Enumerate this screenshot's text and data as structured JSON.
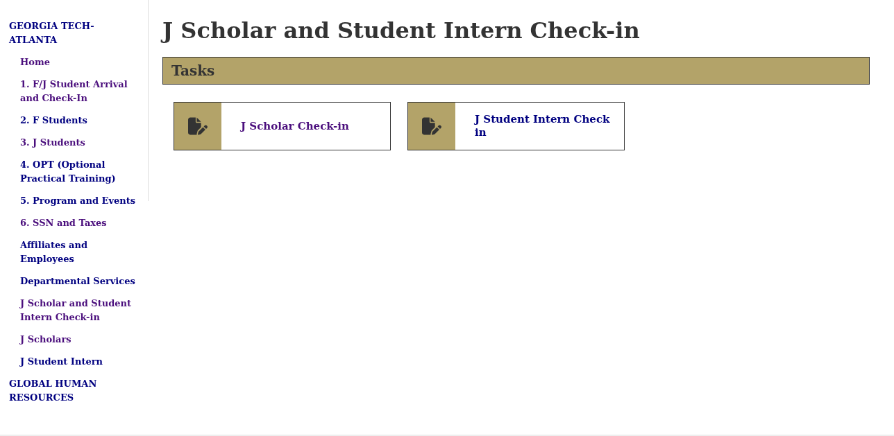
{
  "sidebar": {
    "sections": [
      {
        "label": "GEORGIA TECH-ATLANTA",
        "visited": false,
        "children": [
          {
            "label": "Home",
            "visited": true
          },
          {
            "label": "1. F/J Student Arrival and Check-In",
            "visited": true
          },
          {
            "label": "2. F Students",
            "visited": false
          },
          {
            "label": "3. J Students",
            "visited": true
          },
          {
            "label": "4. OPT (Optional Practical Training)",
            "visited": false
          },
          {
            "label": "5. Program and Events",
            "visited": false
          },
          {
            "label": "6. SSN and Taxes",
            "visited": true
          },
          {
            "label": "Affiliates and Employees",
            "visited": false
          },
          {
            "label": "Departmental Services",
            "visited": false
          },
          {
            "label": "J Scholar and Student Intern Check-in",
            "visited": true
          },
          {
            "label": "J Scholars",
            "visited": true
          },
          {
            "label": "J Student Intern",
            "visited": false
          }
        ]
      },
      {
        "label": "GLOBAL HUMAN RESOURCES",
        "visited": false
      }
    ]
  },
  "page": {
    "title": "J Scholar and Student Intern Check-in",
    "tasks_header": "Tasks",
    "tasks": [
      {
        "label": "J Scholar Check-in",
        "visited": true
      },
      {
        "label": "J Student Intern Check in",
        "visited": false
      }
    ]
  }
}
